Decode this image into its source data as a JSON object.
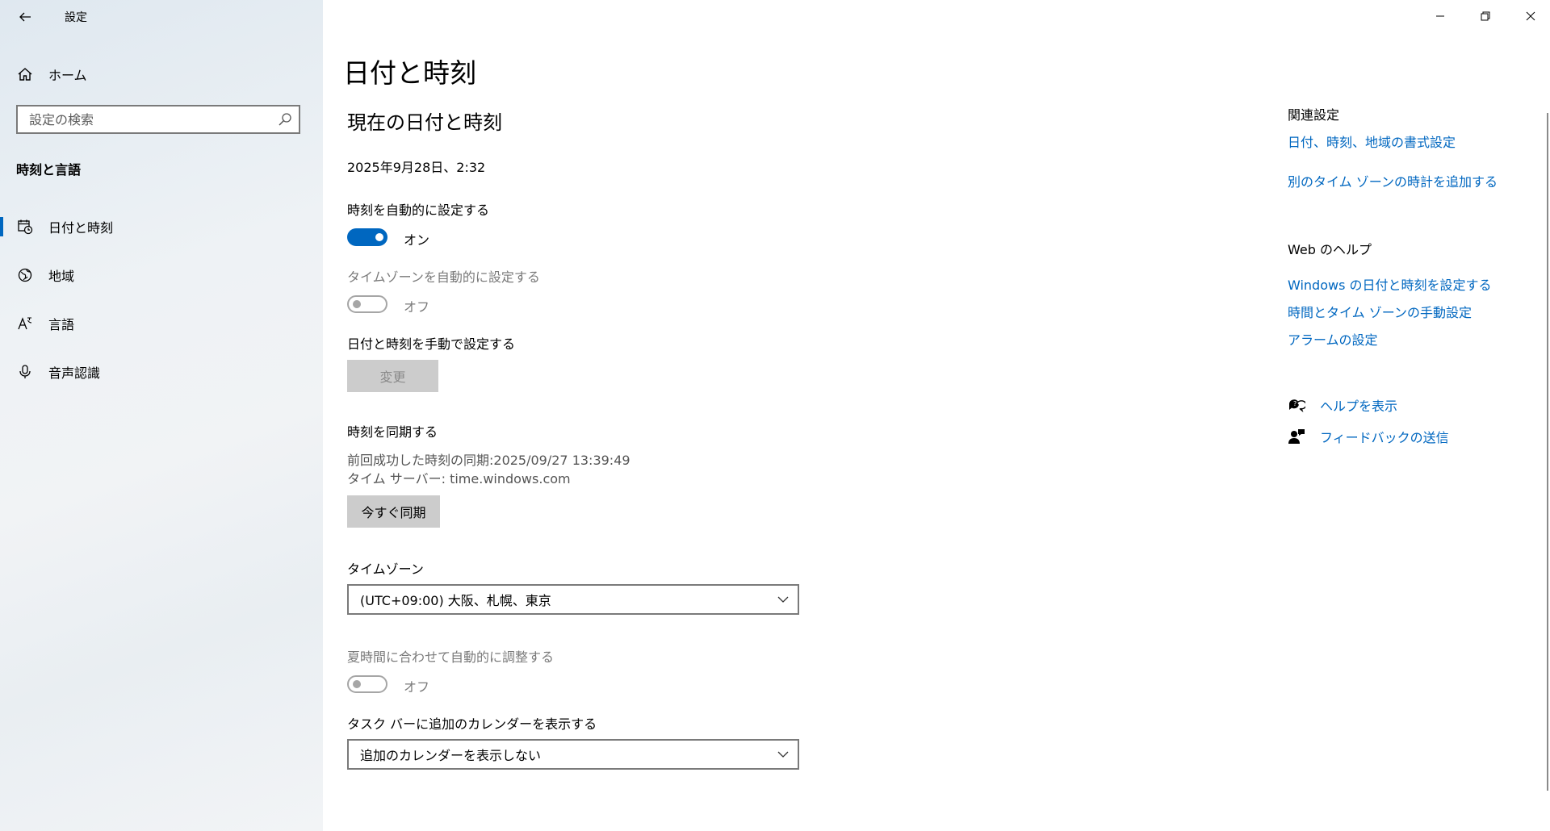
{
  "window": {
    "title": "設定",
    "minimize_icon": "minimize-icon",
    "restore_icon": "restore-icon",
    "close_icon": "close-icon"
  },
  "sidebar": {
    "home_label": "ホーム",
    "search_placeholder": "設定の検索",
    "section_title": "時刻と言語",
    "items": [
      {
        "label": "日付と時刻",
        "icon": "calendar-clock-icon",
        "active": true
      },
      {
        "label": "地域",
        "icon": "globe-icon",
        "active": false
      },
      {
        "label": "言語",
        "icon": "language-icon",
        "active": false
      },
      {
        "label": "音声認識",
        "icon": "microphone-icon",
        "active": false
      }
    ]
  },
  "main": {
    "page_title": "日付と時刻",
    "current_heading": "現在の日付と時刻",
    "current_datetime": "2025年9月28日、2:32",
    "auto_time": {
      "label": "時刻を自動的に設定する",
      "state": "オン",
      "on": true
    },
    "auto_timezone": {
      "label": "タイムゾーンを自動的に設定する",
      "state": "オフ",
      "on": false
    },
    "manual": {
      "label": "日付と時刻を手動で設定する",
      "button": "変更"
    },
    "sync": {
      "label": "時刻を同期する",
      "last_sync": "前回成功した時刻の同期:2025/09/27 13:39:49",
      "server": "タイム サーバー: time.windows.com",
      "button": "今すぐ同期"
    },
    "timezone": {
      "label": "タイムゾーン",
      "value": "(UTC+09:00) 大阪、札幌、東京"
    },
    "dst": {
      "label": "夏時間に合わせて自動的に調整する",
      "state": "オフ",
      "on": false
    },
    "calendar": {
      "label": "タスク バーに追加のカレンダーを表示する",
      "value": "追加のカレンダーを表示しない"
    }
  },
  "related": {
    "heading": "関連設定",
    "links": [
      "日付、時刻、地域の書式設定",
      "別のタイム ゾーンの時計を追加する"
    ]
  },
  "web_help": {
    "heading": "Web のヘルプ",
    "links": [
      "Windows の日付と時刻を設定する",
      "時間とタイム ゾーンの手動設定",
      "アラームの設定"
    ]
  },
  "support": {
    "help": "ヘルプを表示",
    "feedback": "フィードバックの送信"
  },
  "colors": {
    "accent": "#0067c0",
    "disabled_text": "#7a7a7a",
    "button_bg": "#cccccc"
  }
}
